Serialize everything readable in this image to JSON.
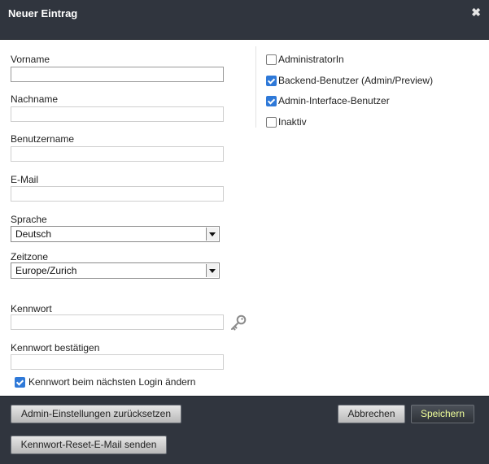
{
  "dialog": {
    "title": "Neuer Eintrag",
    "close_glyph": "✖"
  },
  "form": {
    "vorname_label": "Vorname",
    "vorname_value": "",
    "nachname_label": "Nachname",
    "nachname_value": "",
    "benutzername_label": "Benutzername",
    "benutzername_value": "",
    "email_label": "E-Mail",
    "email_value": "",
    "sprache_label": "Sprache",
    "sprache_value": "Deutsch",
    "zeitzone_label": "Zeitzone",
    "zeitzone_value": "Europe/Zurich",
    "kennwort_label": "Kennwort",
    "kennwort_value": "",
    "kennwort_bestaetigen_label": "Kennwort bestätigen",
    "kennwort_bestaetigen_value": "",
    "change_login_label": "Kennwort beim nächsten Login ändern",
    "change_login_checked": true
  },
  "roles": [
    {
      "label": "AdministratorIn",
      "checked": false
    },
    {
      "label": "Backend-Benutzer (Admin/Preview)",
      "checked": true
    },
    {
      "label": "Admin-Interface-Benutzer",
      "checked": true
    },
    {
      "label": "Inaktiv",
      "checked": false
    }
  ],
  "footer": {
    "reset_label": "Admin-Einstellungen zurücksetzen",
    "reset_mail_label": "Kennwort-Reset-E-Mail senden",
    "cancel_label": "Abbrechen",
    "save_label": "Speichern"
  },
  "icons": {
    "close": "close-icon",
    "key": "key-icon"
  },
  "colors": {
    "header": "#30353e",
    "accent_checkbox": "#2f79d8",
    "save_text": "#f0ff9a"
  }
}
